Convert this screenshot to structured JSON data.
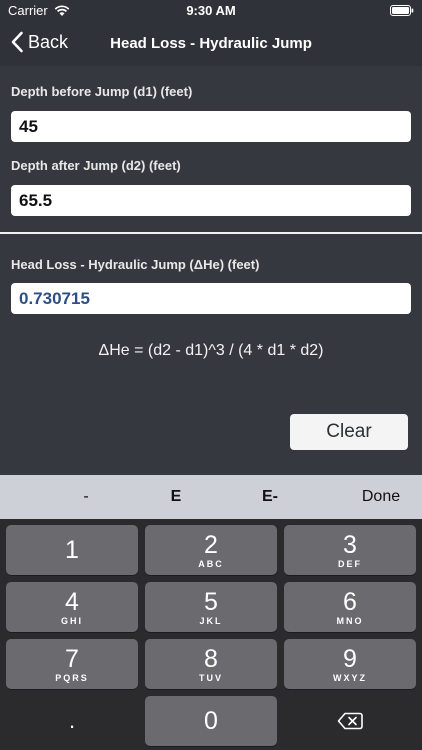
{
  "status_bar": {
    "carrier": "Carrier",
    "time": "9:30 AM"
  },
  "nav": {
    "back_label": "Back",
    "title": "Head Loss - Hydraulic Jump"
  },
  "form": {
    "d1_label": "Depth before Jump (d1) (feet)",
    "d1_value": "45",
    "d2_label": "Depth after Jump (d2) (feet)",
    "d2_value": "65.5",
    "result_label": "Head Loss - Hydraulic Jump (ΔHe) (feet)",
    "result_value": "0.730715",
    "formula": "ΔHe =  (d2 - d1)^3 / (4 * d1 * d2)",
    "clear_label": "Clear"
  },
  "keyboard": {
    "accessory": [
      "-",
      "E",
      "E-",
      "Done"
    ],
    "keys": [
      {
        "digit": "1",
        "letters": ""
      },
      {
        "digit": "2",
        "letters": "ABC"
      },
      {
        "digit": "3",
        "letters": "DEF"
      },
      {
        "digit": "4",
        "letters": "GHI"
      },
      {
        "digit": "5",
        "letters": "JKL"
      },
      {
        "digit": "6",
        "letters": "MNO"
      },
      {
        "digit": "7",
        "letters": "PQRS"
      },
      {
        "digit": "8",
        "letters": "TUV"
      },
      {
        "digit": "9",
        "letters": "WXYZ"
      }
    ],
    "decimal": ".",
    "zero": "0"
  },
  "colors": {
    "background": "#35393f",
    "bar": "#2f3238",
    "result_text": "#2e4f85",
    "key": "#6b6b6f"
  }
}
